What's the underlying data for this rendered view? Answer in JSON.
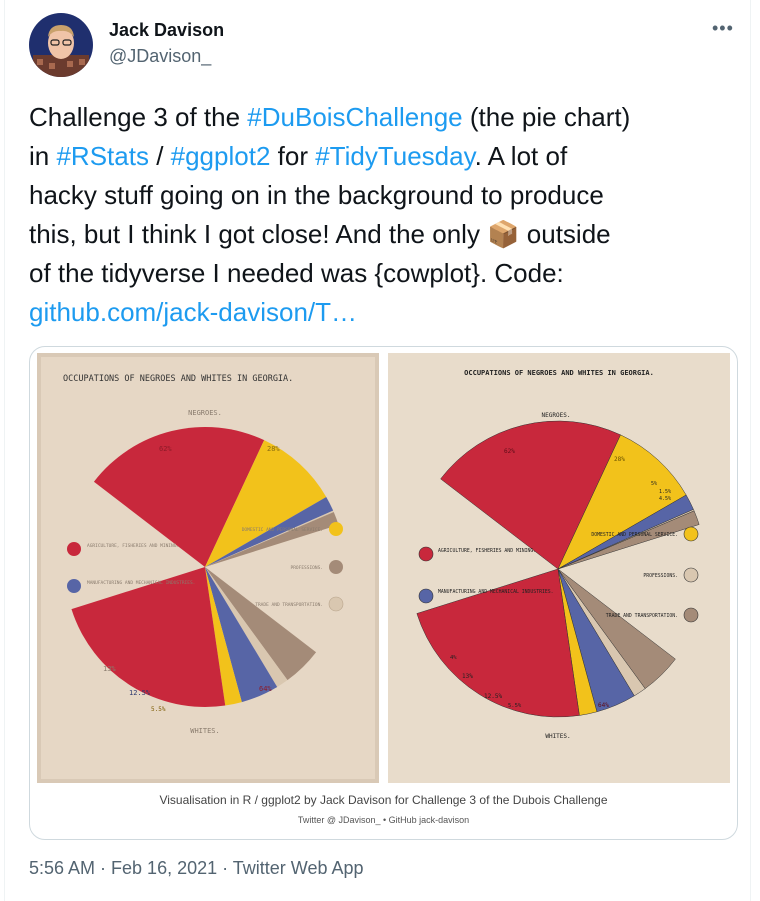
{
  "author": {
    "name": "Jack Davison",
    "handle": "@JDavison_"
  },
  "menu_icon": "more-horizontal-icon",
  "tweet": {
    "t1": "Challenge 3 of the ",
    "h1": "#DuBoisChallenge",
    "t2": " (the pie chart)",
    "t3": "in ",
    "h2": "#RStats",
    "t4": " / ",
    "h3": "#ggplot2",
    "t5": " for ",
    "h4": "#TidyTuesday",
    "t6": ". A lot of",
    "t7": "hacky stuff going on in the background to produce",
    "t8": "this, but I think I got close! And the only ",
    "emoji": "📦",
    "t9": " outside",
    "t10": "of the tidyverse I needed was {cowplot}. Code:",
    "link": "github.com/jack-davison/T…"
  },
  "left_chart": {
    "title": "OCCUPATIONS OF NEGROES AND WHITES IN GEORGIA.",
    "top_label": "NEGROES.",
    "bottom_label": "WHITES.",
    "top_pct": [
      "62%",
      "28%"
    ],
    "bottom_pct": [
      "13%",
      "12.5%",
      "5.5%",
      "64%"
    ],
    "legend": {
      "agriculture": "AGRICULTURE, FISHERIES AND MINING.",
      "manufacturing": "MANUFACTURING AND MECHANICAL INDUSTRIES.",
      "domestic": "DOMESTIC AND PERSONAL SERVICE.",
      "professions": "PROFESSIONS.",
      "trade": "TRADE AND TRANSPORTATION."
    }
  },
  "right_chart": {
    "title": "OCCUPATIONS OF NEGROES AND WHITES IN GEORGIA.",
    "top_label": "NEGROES.",
    "bottom_label": "WHITES.",
    "top_pct": [
      "62%",
      "28%",
      "5%",
      "1.5%",
      "4.5%"
    ],
    "bottom_pct": [
      "4%",
      "13%",
      "12.5%",
      "5.5%",
      "64%"
    ],
    "legend": {
      "agriculture": "AGRICULTURE, FISHERIES AND MINING.",
      "manufacturing": "MANUFACTURING AND MECHANICAL INDUSTRIES.",
      "domestic": "DOMESTIC AND PERSONAL SERVICE.",
      "professions": "PROFESSIONS.",
      "trade": "TRADE AND TRANSPORTATION."
    }
  },
  "chart_data": [
    {
      "type": "pie",
      "title": "OCCUPATIONS OF NEGROES AND WHITES IN GEORGIA.",
      "categories": [
        "AGRICULTURE, FISHERIES AND MINING.",
        "DOMESTIC AND PERSONAL SERVICE.",
        "MANUFACTURING AND MECHANICAL INDUSTRIES.",
        "PROFESSIONS.",
        "TRADE AND TRANSPORTATION."
      ],
      "series": [
        {
          "name": "NEGROES.",
          "values": [
            62,
            28,
            5,
            0.5,
            4.5
          ]
        },
        {
          "name": "WHITES.",
          "values": [
            64,
            5.5,
            12.5,
            4,
            13
          ]
        }
      ]
    }
  ],
  "colors": {
    "agriculture": "#c8283c",
    "domestic": "#f2c21b",
    "manufacturing": "#5765a6",
    "professions": "#d9c7b0",
    "trade": "#a48b78",
    "link": "#1d9bf0"
  },
  "caption": {
    "line1": "Visualisation in R / ggplot2 by Jack Davison for Challenge 3 of the Dubois Challenge",
    "line2": "Twitter @ JDavison_ • GitHub jack-davison"
  },
  "meta": {
    "timestamp": "5:56 AM · Feb 16, 2021 · Twitter Web App"
  }
}
